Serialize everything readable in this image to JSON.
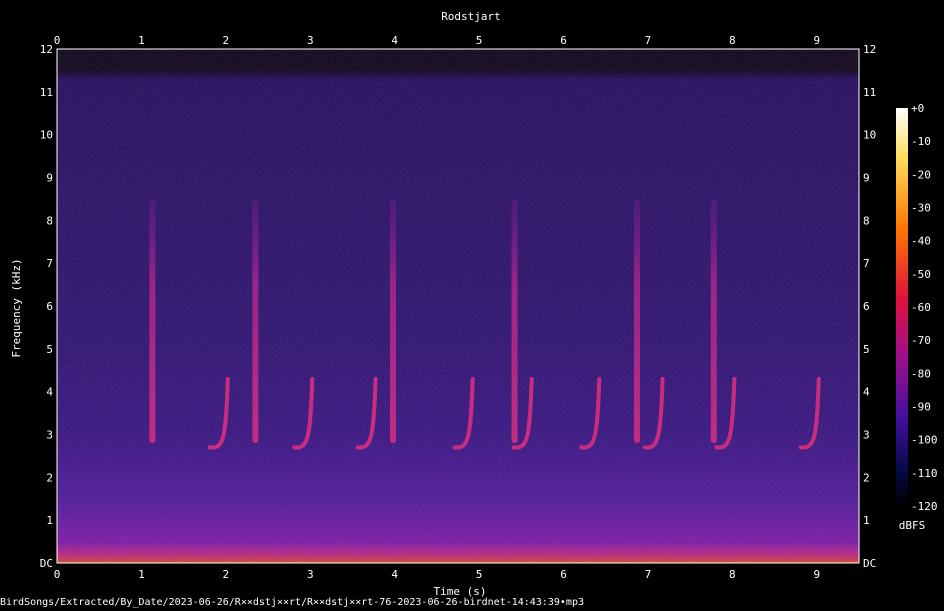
{
  "chart_data": {
    "type": "heatmap",
    "subtype": "spectrogram",
    "title": "Rodstjart",
    "xlabel": "Time (s)",
    "ylabel": "Frequency (kHz)",
    "xlim": [
      0,
      9.5
    ],
    "ylim": [
      0,
      12
    ],
    "x_ticks": [
      "0",
      "1",
      "2",
      "3",
      "4",
      "5",
      "6",
      "7",
      "8",
      "9"
    ],
    "y_ticks": [
      "DC",
      "1",
      "2",
      "3",
      "4",
      "5",
      "6",
      "7",
      "8",
      "9",
      "10",
      "11",
      "12"
    ],
    "colorbar": {
      "label": "dBFS",
      "range": [
        -120,
        0
      ],
      "ticks": [
        "+0",
        "-10",
        "-20",
        "-30",
        "-40",
        "-50",
        "-60",
        "-70",
        "-80",
        "-90",
        "-100",
        "-110",
        "-120"
      ]
    },
    "colors": {
      "background": "#000000",
      "noise": "#1c0a52",
      "call": "#d02a88",
      "low_band": "#6a1aa0",
      "dc_band": "#e05010"
    },
    "broadband_clicks_s": [
      1.13,
      2.35,
      3.98,
      5.42,
      6.87,
      7.78
    ],
    "chirp_calls_s": [
      2.0,
      3.0,
      3.75,
      4.9,
      5.6,
      6.4,
      7.15,
      8.0,
      9.0
    ],
    "chirp_freq_khz": [
      2.7,
      4.3
    ]
  },
  "footer": {
    "path": "BirdSongs/Extracted/By_Date/2023-06-26/R××dstj××rt/R××dstj××rt-76-2023-06-26-birdnet-14:43:39•mp3"
  }
}
